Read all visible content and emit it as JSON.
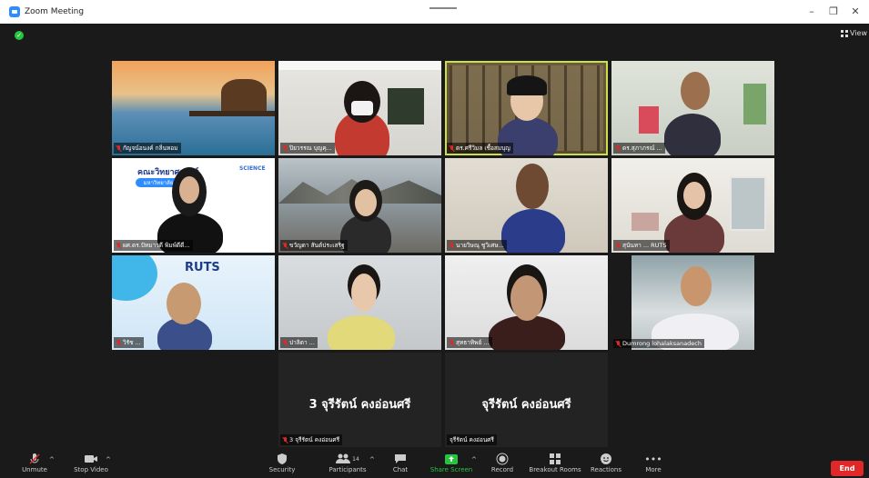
{
  "window": {
    "title": "Zoom Meeting"
  },
  "header": {
    "view_label": "View"
  },
  "participants": [
    {
      "name": "กัญจน์อนงค์ กลิ่นหอม"
    },
    {
      "name": "ปิยวรรณ บุญคุ..."
    },
    {
      "name": "ดร.ศรีวิมล เชื้อสมบุญ"
    },
    {
      "name": "ดร.สุภาภรณ์ ..."
    },
    {
      "name": "ผศ.ดร.ปัทมาวดี พิมพ์ดีดี..."
    },
    {
      "name": "ขวัญตา สันต์ประเสริฐ"
    },
    {
      "name": "นายวิษณุ ชูวิเศษ..."
    },
    {
      "name": "สุนันทา ... RUTS"
    },
    {
      "name": "วิรัช ..."
    },
    {
      "name": "ปาลิตา ..."
    },
    {
      "name": "สุทธาทิพย์ ..."
    },
    {
      "name": "Dumrong lohalaksanadech"
    },
    {
      "name": "3 จุรีรัตน์ คงอ่อนศรี",
      "display": "3 จุรีรัตน์ คงอ่อนศรี"
    },
    {
      "name": "จุรีรัตน์ คงอ่อนศรี",
      "display": "จุรีรัตน์ คงอ่อนศรี"
    }
  ],
  "brand": {
    "rts_logo": "RUTS",
    "faculty_banner": "คณะวิทยาศาสตร์",
    "faculty_sub": "มหาวิทยาลัย",
    "science_badge": "SCIENCE"
  },
  "toolbar": {
    "unmute": "Unmute",
    "stop_video": "Stop Video",
    "security": "Security",
    "participants": "Participants",
    "participants_count": "14",
    "chat": "Chat",
    "share_screen": "Share Screen",
    "record": "Record",
    "breakout_rooms": "Breakout Rooms",
    "reactions": "Reactions",
    "more": "More",
    "end": "End"
  },
  "colors": {
    "active_speaker": "#c8e04a",
    "end_button": "#e02828",
    "share_green": "#26c440"
  }
}
